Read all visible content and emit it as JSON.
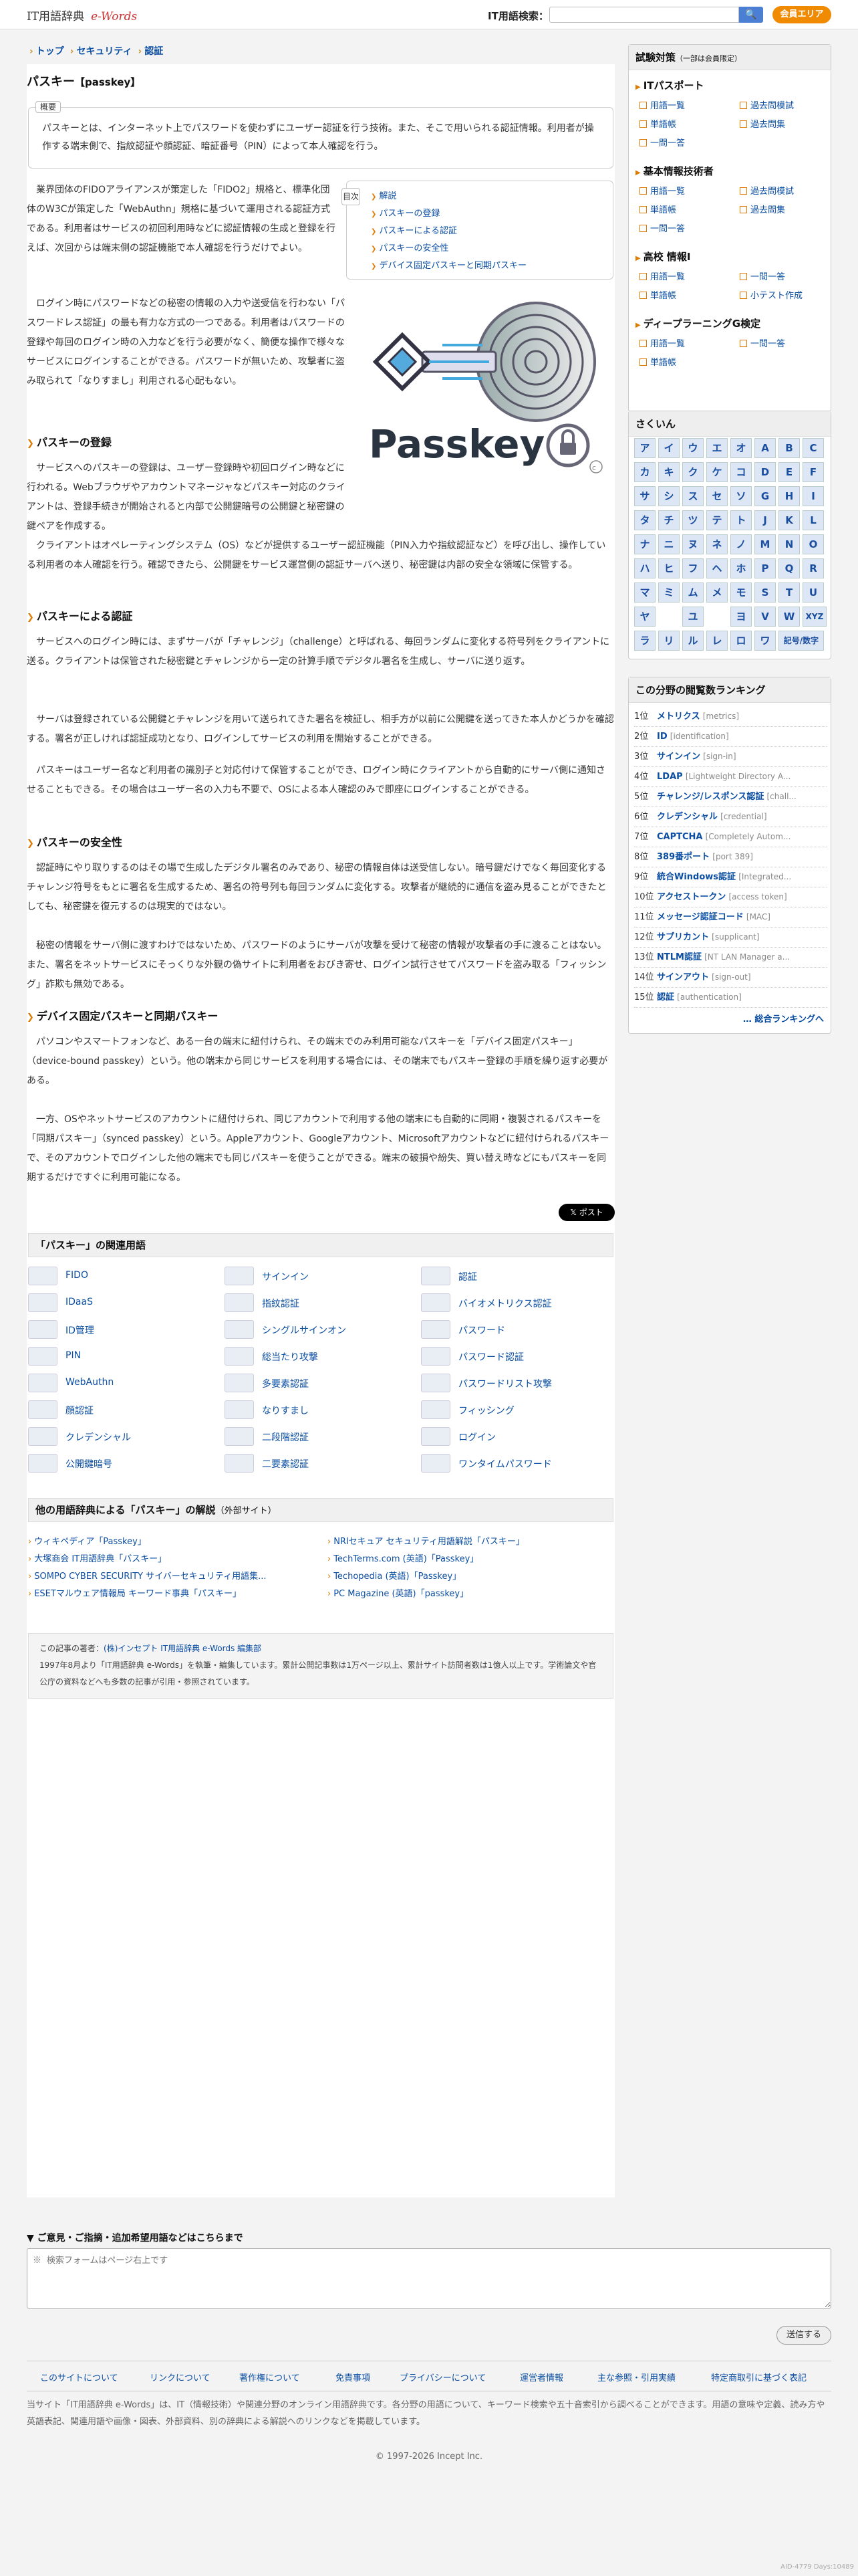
{
  "header": {
    "logo_text": "IT用語辞典",
    "logo_brand": "e-Words",
    "search_label": "IT用語検索：",
    "search_placeholder": "",
    "search_icon": "search-icon",
    "member_button": "会員エリア"
  },
  "breadcrumb": [
    "トップ",
    "セキュリティ",
    "認証"
  ],
  "page": {
    "title": "パスキー",
    "title_en": "【passkey】",
    "summary_label": "概要",
    "summary": "パスキーとは、インターネット上でパスワードを使わずにユーザー認証を行う技術。また、そこで用いられる認証情報。利用者が操作する端末側で、指紋認証や顔認証、暗証番号（PIN）によって本人確認を行う。",
    "toc_label": "目次",
    "toc": [
      "解説",
      "パスキーの登録",
      "パスキーによる認証",
      "パスキーの安全性",
      "デバイス固定パスキーと同期パスキー"
    ],
    "hero_alt": "Passkey",
    "p1": "業界団体のFIDOアライアンスが策定した「FIDO2」規格と、標準化団体のW3Cが策定した「WebAuthn」規格に基づいて運用される認証方式である。利用者はサービスの初回利用時などに認証情報の生成と登録を行えば、次回からは端末側の認証機能で本人確認を行うだけでよい。",
    "p2": "ログイン時にパスワードなどの秘密の情報の入力や送受信を行わない「パスワードレス認証」の最も有力な方式の一つである。利用者はパスワードの登録や毎回のログイン時の入力などを行う必要がなく、簡便な操作で様々なサービスにログインすることができる。パスワードが無いため、攻撃者に盗み取られて「なりすまし」利用される心配もない。",
    "h1": "パスキーの登録",
    "p3": "サービスへのパスキーの登録は、ユーザー登録時や初回ログイン時などに行われる。Webブラウザやアカウントマネージャなどパスキー対応のクライアントは、登録手続きが開始されると内部で公開鍵暗号の公開鍵と秘密鍵の鍵ペアを作成する。",
    "p4": "クライアントはオペレーティングシステム（OS）などが提供するユーザー認証機能（PIN入力や指紋認証など）を呼び出し、操作している利用者の本人確認を行う。確認できたら、公開鍵をサービス運営側の認証サーバへ送り、秘密鍵は内部の安全な領域に保管する。",
    "h2": "パスキーによる認証",
    "p5": "サービスへのログイン時には、まずサーバが「チャレンジ」（challenge）と呼ばれる、毎回ランダムに変化する符号列をクライアントに送る。クライアントは保管された秘密鍵とチャレンジから一定の計算手順でデジタル署名を生成し、サーバに送り返す。",
    "p6": "サーバは登録されている公開鍵とチャレンジを用いて送られてきた署名を検証し、相手方が以前に公開鍵を送ってきた本人かどうかを確認する。署名が正しければ認証成功となり、ログインしてサービスの利用を開始することができる。",
    "p7": "パスキーはユーザー名など利用者の識別子と対応付けて保管することができ、ログイン時にクライアントから自動的にサーバ側に通知させることもできる。その場合はユーザー名の入力も不要で、OSによる本人確認のみで即座にログインすることができる。",
    "h3": "パスキーの安全性",
    "p8": "認証時にやり取りするのはその場で生成したデジタル署名のみであり、秘密の情報自体は送受信しない。暗号鍵だけでなく毎回変化するチャレンジ符号をもとに署名を生成するため、署名の符号列も毎回ランダムに変化する。攻撃者が継続的に通信を盗み見ることができたとしても、秘密鍵を復元するのは現実的ではない。",
    "p9": "秘密の情報をサーバ側に渡すわけではないため、パスワードのようにサーバが攻撃を受けて秘密の情報が攻撃者の手に渡ることはない。また、署名をネットサービスにそっくりな外観の偽サイトに利用者をおびき寄せ、ログイン試行させてパスワードを盗み取る「フィッシング」詐欺も無効である。",
    "h4": "デバイス固定パスキーと同期パスキー",
    "p10": "パソコンやスマートフォンなど、ある一台の端末に紐付けられ、その端末でのみ利用可能なパスキーを「デバイス固定パスキー」（device-bound passkey）という。他の端末から同じサービスを利用する場合には、その端末でもパスキー登録の手順を繰り返す必要がある。",
    "p11": "一方、OSやネットサービスのアカウントに紐付けられ、同じアカウントで利用する他の端末にも自動的に同期・複製されるパスキーを「同期パスキー」（synced passkey）という。Appleアカウント、Googleアカウント、Microsoftアカウントなどに紐付けられるパスキーで、そのアカウントでログインした他の端末でも同じパスキーを使うことができる。端末の破損や紛失、買い替え時などにもパスキーを同期するだけですぐに利用可能になる。",
    "post_button": "ポスト"
  },
  "related": {
    "title": "「パスキー」の関連用語",
    "items": [
      "FIDO",
      "サインイン",
      "認証",
      "IDaaS",
      "指紋認証",
      "バイオメトリクス認証",
      "ID管理",
      "シングルサインオン",
      "パスワード",
      "PIN",
      "総当たり攻撃",
      "パスワード認証",
      "WebAuthn",
      "多要素認証",
      "パスワードリスト攻撃",
      "顔認証",
      "なりすまし",
      "フィッシング",
      "クレデンシャル",
      "二段階認証",
      "ログイン",
      "公開鍵暗号",
      "二要素認証",
      "ワンタイムパスワード"
    ]
  },
  "external": {
    "title": "他の用語辞典による「パスキー」の解説",
    "title_suffix": "（外部サイト）",
    "left": [
      "ウィキペディア「Passkey」",
      "大塚商会 IT用語辞典「パスキー」",
      "SOMPO CYBER SECURITY サイバーセキュリティ用語集...",
      "ESETマルウェア情報局 キーワード事典「パスキー」"
    ],
    "right": [
      "NRIセキュア セキュリティ用語解説「パスキー」",
      "TechTerms.com (英語)「Passkey」",
      "Techopedia (英語)「Passkey」",
      "PC Magazine (英語)「passkey」"
    ]
  },
  "author": {
    "line1_label": "この記事の著者：",
    "line1_value": "(株)インセプト IT用語辞典 e-Words 編集部",
    "line2": "1997年8月より「IT用語辞典 e-Words」を執筆・編集しています。累計公開記事数は1万ページ以上、累計サイト訪問者数は1億人以上です。学術論文や官公庁の資料などへも多数の記事が引用・参照されています。"
  },
  "sidebar": {
    "exam_title": "試験対策",
    "exam_note": "（一部は会員限定）",
    "categories": [
      {
        "name": "ITパスポート",
        "links": [
          "用語一覧",
          "過去問模試",
          "単語帳",
          "過去問集",
          "一問一答"
        ]
      },
      {
        "name": "基本情報技術者",
        "links": [
          "用語一覧",
          "過去問模試",
          "単語帳",
          "過去問集",
          "一問一答"
        ]
      },
      {
        "name": "高校 情報Ⅰ",
        "links": [
          "用語一覧",
          "一問一答",
          "単語帳",
          "小テスト作成"
        ]
      },
      {
        "name": "ディープラーニングG検定",
        "links": [
          "用語一覧",
          "一問一答",
          "単語帳"
        ]
      }
    ],
    "kana_title": "さくいん",
    "kana": [
      [
        "ア",
        "イ",
        "ウ",
        "エ",
        "オ",
        "A",
        "B",
        "C"
      ],
      [
        "カ",
        "キ",
        "ク",
        "ケ",
        "コ",
        "D",
        "E",
        "F"
      ],
      [
        "サ",
        "シ",
        "ス",
        "セ",
        "ソ",
        "G",
        "H",
        "I"
      ],
      [
        "タ",
        "チ",
        "ツ",
        "テ",
        "ト",
        "J",
        "K",
        "L"
      ],
      [
        "ナ",
        "ニ",
        "ヌ",
        "ネ",
        "ノ",
        "M",
        "N",
        "O"
      ],
      [
        "ハ",
        "ヒ",
        "フ",
        "ヘ",
        "ホ",
        "P",
        "Q",
        "R"
      ],
      [
        "マ",
        "ミ",
        "ム",
        "メ",
        "モ",
        "S",
        "T",
        "U"
      ],
      [
        "ヤ",
        "",
        "ユ",
        "",
        "ヨ",
        "V",
        "W",
        "XYZ"
      ],
      [
        "ラ",
        "リ",
        "ル",
        "レ",
        "ロ",
        "ワ",
        "記号/数字",
        ""
      ]
    ],
    "ranking_title": "この分野の閲覧数ランキング",
    "ranking": [
      {
        "rank": "1位",
        "word": "メトリクス",
        "reading": "[metrics]"
      },
      {
        "rank": "2位",
        "word": "ID",
        "reading": "[identification]"
      },
      {
        "rank": "3位",
        "word": "サインイン",
        "reading": "[sign-in]"
      },
      {
        "rank": "4位",
        "word": "LDAP",
        "reading": "[Lightweight Directory A..."
      },
      {
        "rank": "5位",
        "word": "チャレンジ/レスポンス認証",
        "reading": "[chall..."
      },
      {
        "rank": "6位",
        "word": "クレデンシャル",
        "reading": "[credential]"
      },
      {
        "rank": "7位",
        "word": "CAPTCHA",
        "reading": "[Completely Autom..."
      },
      {
        "rank": "8位",
        "word": "389番ポート",
        "reading": "[port 389]"
      },
      {
        "rank": "9位",
        "word": "統合Windows認証",
        "reading": "[Integrated..."
      },
      {
        "rank": "10位",
        "word": "アクセストークン",
        "reading": "[access token]"
      },
      {
        "rank": "11位",
        "word": "メッセージ認証コード",
        "reading": "[MAC]"
      },
      {
        "rank": "12位",
        "word": "サプリカント",
        "reading": "[supplicant]"
      },
      {
        "rank": "13位",
        "word": "NTLM認証",
        "reading": "[NT LAN Manager a..."
      },
      {
        "rank": "14位",
        "word": "サインアウト",
        "reading": "[sign-out]"
      },
      {
        "rank": "15位",
        "word": "認証",
        "reading": "[authentication]"
      }
    ],
    "ranking_more": "… 総合ランキングへ"
  },
  "footer": {
    "form_title": "▼ ご意見・ご指摘・追加希望用語などはこちらまで",
    "form_placeholder": "※ 検索フォームはページ右上です",
    "send_button": "送信する",
    "links": [
      "このサイトについて",
      "リンクについて",
      "著作権について",
      "免責事項",
      "プライバシーについて",
      "運営者情報",
      "主な参照・引用実績",
      "特定商取引に基づく表記"
    ],
    "note": "当サイト「IT用語辞典 e-Words」は、IT（情報技術）や関連分野のオンライン用語辞典です。各分野の用語について、キーワード検索や五十音索引から調べることができます。用語の意味や定義、読み方や英語表記、関連用語や画像・図表、外部資料、別の辞典による解説へのリンクなどを掲載しています。",
    "copyright": "© 1997-2026 Incept Inc.",
    "corner_code": "AID-4779   Days:10489"
  }
}
